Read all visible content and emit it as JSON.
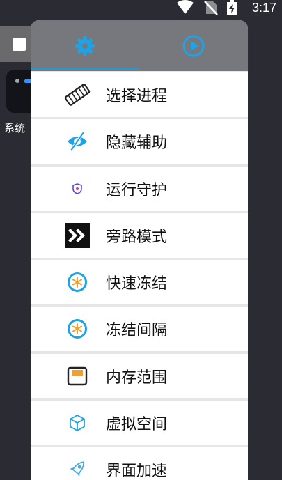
{
  "status_bar": {
    "time": "3:17"
  },
  "launcher": {
    "app_label": "系统"
  },
  "panel": {
    "tabs": [
      {
        "icon": "gear-icon",
        "active": true
      },
      {
        "icon": "play-circle-icon",
        "active": false
      }
    ],
    "menu": [
      {
        "label": "选择进程",
        "icon": "memory-chip-icon"
      },
      {
        "label": "隐藏辅助",
        "icon": "eye-off-icon"
      },
      {
        "label": "运行守护",
        "icon": "shield-icon"
      },
      {
        "label": "旁路模式",
        "icon": "double-chevron-icon"
      },
      {
        "label": "快速冻结",
        "icon": "snowflake-icon"
      },
      {
        "label": "冻结间隔",
        "icon": "snowflake-icon"
      },
      {
        "label": "内存范围",
        "icon": "storage-icon"
      },
      {
        "label": "虚拟空间",
        "icon": "cube-icon"
      },
      {
        "label": "界面加速",
        "icon": "rocket-icon"
      }
    ]
  },
  "colors": {
    "accent": "#1e9bd7",
    "icon_blue": "#1ea3e6",
    "tab_bar": "#77787d"
  }
}
